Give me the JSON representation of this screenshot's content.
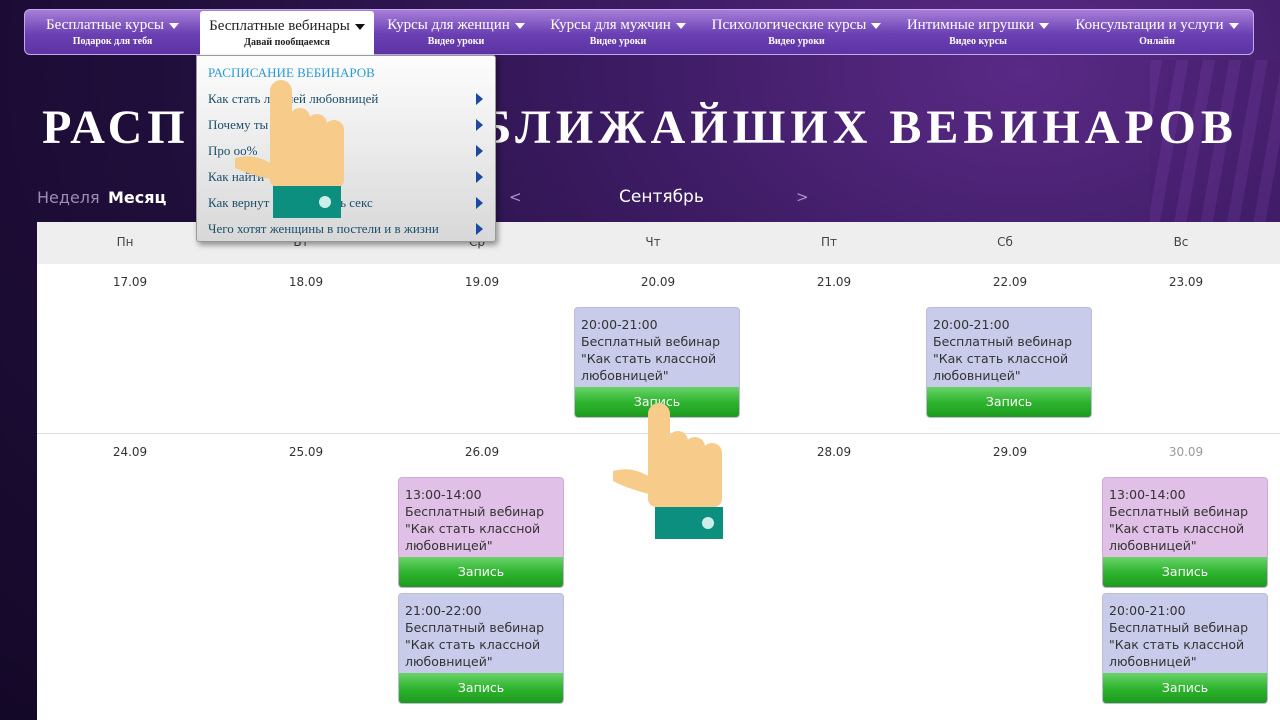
{
  "nav": [
    {
      "label": "Бесплатные курсы",
      "sub": "Подарок для тебя"
    },
    {
      "label": "Бесплатные вебинары",
      "sub": "Давай пообщаемся"
    },
    {
      "label": "Курсы для женщин",
      "sub": "Видео уроки"
    },
    {
      "label": "Курсы для мужчин",
      "sub": "Видео уроки"
    },
    {
      "label": "Психологические курсы",
      "sub": "Видео уроки"
    },
    {
      "label": "Интимные игрушки",
      "sub": "Видео курсы"
    },
    {
      "label": "Консультации и услуги",
      "sub": "Онлайн"
    }
  ],
  "dropdown": {
    "header": "РАСПИСАНИЕ ВЕБИНАРОВ",
    "items": [
      "Как стать лучшей любовницей",
      "Почему ты",
      "Про                          оо%",
      "Как найти",
      "Как вернут             азнообразить секс",
      "Чего хотят женщины в постели и в жизни"
    ]
  },
  "heading": {
    "left": "РАСП",
    "right": "БЛИЖАЙШИХ ВЕБИНАРОВ"
  },
  "view": {
    "week": "Неделя",
    "month": "Месяц"
  },
  "month": {
    "prev": "<",
    "name": "Сентябрь",
    "next": ">"
  },
  "weekdays": [
    "Пн",
    "Вт",
    "Ср",
    "Чт",
    "Пт",
    "Сб",
    "Вс"
  ],
  "weeks": [
    [
      "17.09",
      "18.09",
      "19.09",
      "20.09",
      "21.09",
      "22.09",
      "23.09"
    ],
    [
      "24.09",
      "25.09",
      "26.09",
      "27",
      "28.09",
      "29.09",
      "30.09"
    ]
  ],
  "events": {
    "e1": {
      "time": "20:00-21:00",
      "title": "Бесплатный вебинар",
      "name": "\"Как стать классной",
      "name2": "любовницей\"",
      "button": "Запись"
    },
    "e2": {
      "time": "20:00-21:00",
      "title": "Бесплатный вебинар",
      "name": "\"Как стать классной",
      "name2": "любовницей\"",
      "button": "Запись"
    },
    "e3": {
      "time": "13:00-14:00",
      "title": "Бесплатный вебинар",
      "name": "\"Как стать классной",
      "name2": "любовницей\"",
      "button": "Запись"
    },
    "e4": {
      "time": "21:00-22:00",
      "title": "Бесплатный вебинар",
      "name": "\"Как стать классной",
      "name2": "любовницей\"",
      "button": "Запись"
    },
    "e5": {
      "time": "13:00-14:00",
      "title": "Бесплатный вебинар",
      "name": "\"Как стать классной",
      "name2": "любовницей\"",
      "button": "Запись"
    },
    "e6": {
      "time": "20:00-21:00",
      "title": "Бесплатный вебинар",
      "name": "\"Как стать классной",
      "name2": "любовницей\"",
      "button": "Запись"
    }
  },
  "colors": {
    "accent": "#6a3fb3",
    "event_blue": "#c8cbe9",
    "event_pink": "#e0c0e6",
    "button_green": "#2fb52f",
    "hand_skin": "#f7cb8a",
    "cuff": "#0d8f80"
  },
  "icons": {
    "pointer": "pointing-hand-icon"
  }
}
